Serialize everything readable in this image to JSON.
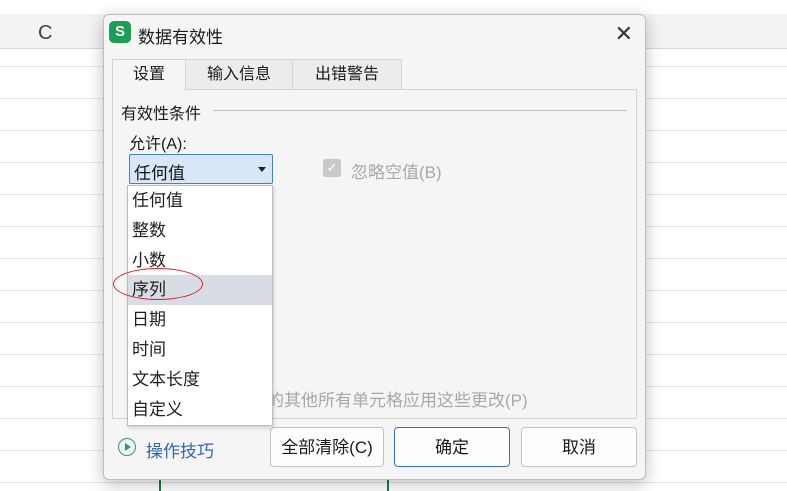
{
  "sheet": {
    "column_label": "C"
  },
  "dialog": {
    "app_icon_letter": "S",
    "title": "数据有效性",
    "close_glyph": "✕",
    "tabs": [
      {
        "label": "设置"
      },
      {
        "label": "输入信息"
      },
      {
        "label": "出错警告"
      }
    ],
    "group_title": "有效性条件",
    "allow_label": "允许(A):",
    "allow_value": "任何值",
    "ignore_blank_label": "忽略空值(B)",
    "ignore_blank_checked": true,
    "apply_all_text": "置的其他所有单元格应用这些更改(P)",
    "dropdown_options": [
      "任何值",
      "整数",
      "小数",
      "序列",
      "日期",
      "时间",
      "文本长度",
      "自定义"
    ],
    "highlighted_option": "序列",
    "tips_label": "操作技巧",
    "buttons": {
      "clear_all": "全部清除(C)",
      "ok": "确定",
      "cancel": "取消"
    }
  },
  "colors": {
    "app_icon": "#1b9e56",
    "select_bg": "#d8e6f7",
    "select_border": "#4a7fc1",
    "highlight": "#d8dde5",
    "annotation_oval": "#d9262a",
    "tips_text": "#2e66b8",
    "tips_icon": "#24a060",
    "ok_border": "#3a6ec2"
  }
}
